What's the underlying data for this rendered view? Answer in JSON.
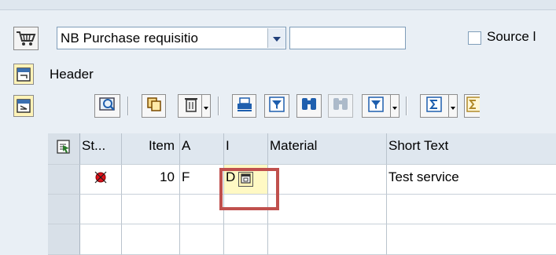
{
  "header_area": {
    "document_type_value": "NB Purchase requisitio",
    "document_number_value": "",
    "source_label": "Source l",
    "source_checked": false,
    "header_label": "Header"
  },
  "toolbar": {
    "buttons": [
      "details-icon",
      "copy-icon",
      "delete-icon",
      "print-icon",
      "filter-icon",
      "find-icon",
      "find-next-icon",
      "set-filter-icon",
      "sum-icon",
      "subtotal-icon"
    ]
  },
  "grid": {
    "columns": [
      "St...",
      "Item",
      "A",
      "I",
      "Material",
      "Short Text"
    ],
    "rows": [
      {
        "status": "error-icon",
        "item": "10",
        "account_assignment": "F",
        "item_category": "D",
        "material": "",
        "short_text": "Test service"
      },
      {
        "status": "",
        "item": "",
        "account_assignment": "",
        "item_category": "",
        "material": "",
        "short_text": ""
      },
      {
        "status": "",
        "item": "",
        "account_assignment": "",
        "item_category": "",
        "material": "",
        "short_text": ""
      }
    ]
  },
  "colors": {
    "panel_bg": "#e9eff5",
    "highlight": "#c0504d",
    "icon_button_bg": "#fff3b8",
    "error_icon": "#e0101a"
  }
}
